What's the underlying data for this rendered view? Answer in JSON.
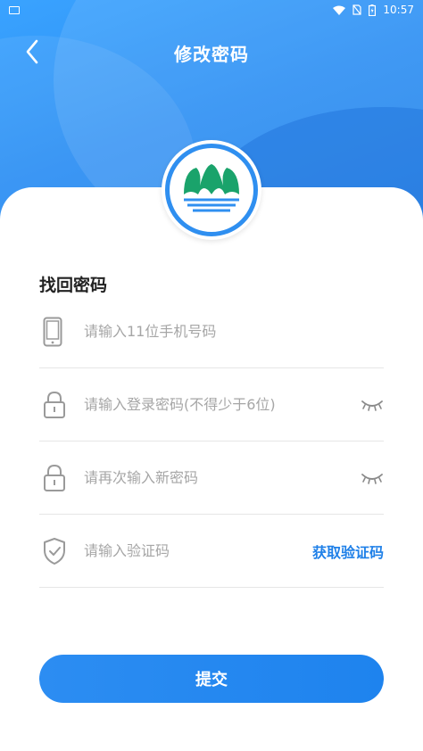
{
  "status_bar": {
    "time": "10:57"
  },
  "header": {
    "title": "修改密码",
    "back_icon": "chevron-left-icon"
  },
  "section": {
    "title": "找回密码"
  },
  "form": {
    "phone": {
      "placeholder": "请输入11位手机号码",
      "value": "",
      "icon": "phone-icon"
    },
    "password": {
      "placeholder": "请输入登录密码(不得少于6位)",
      "value": "",
      "icon": "lock-icon",
      "toggle_icon": "eye-closed-icon"
    },
    "confirm_password": {
      "placeholder": "请再次输入新密码",
      "value": "",
      "icon": "lock-icon",
      "toggle_icon": "eye-closed-icon"
    },
    "verify_code": {
      "placeholder": "请输入验证码",
      "value": "",
      "icon": "shield-check-icon",
      "get_code_label": "获取验证码"
    }
  },
  "submit": {
    "label": "提交"
  },
  "colors": {
    "primary": "#1f80e8",
    "header_gradient_start": "#3aa3ff",
    "header_gradient_end": "#1f7fe6",
    "logo_green": "#1aa36b",
    "logo_blue": "#2f8ff0"
  }
}
